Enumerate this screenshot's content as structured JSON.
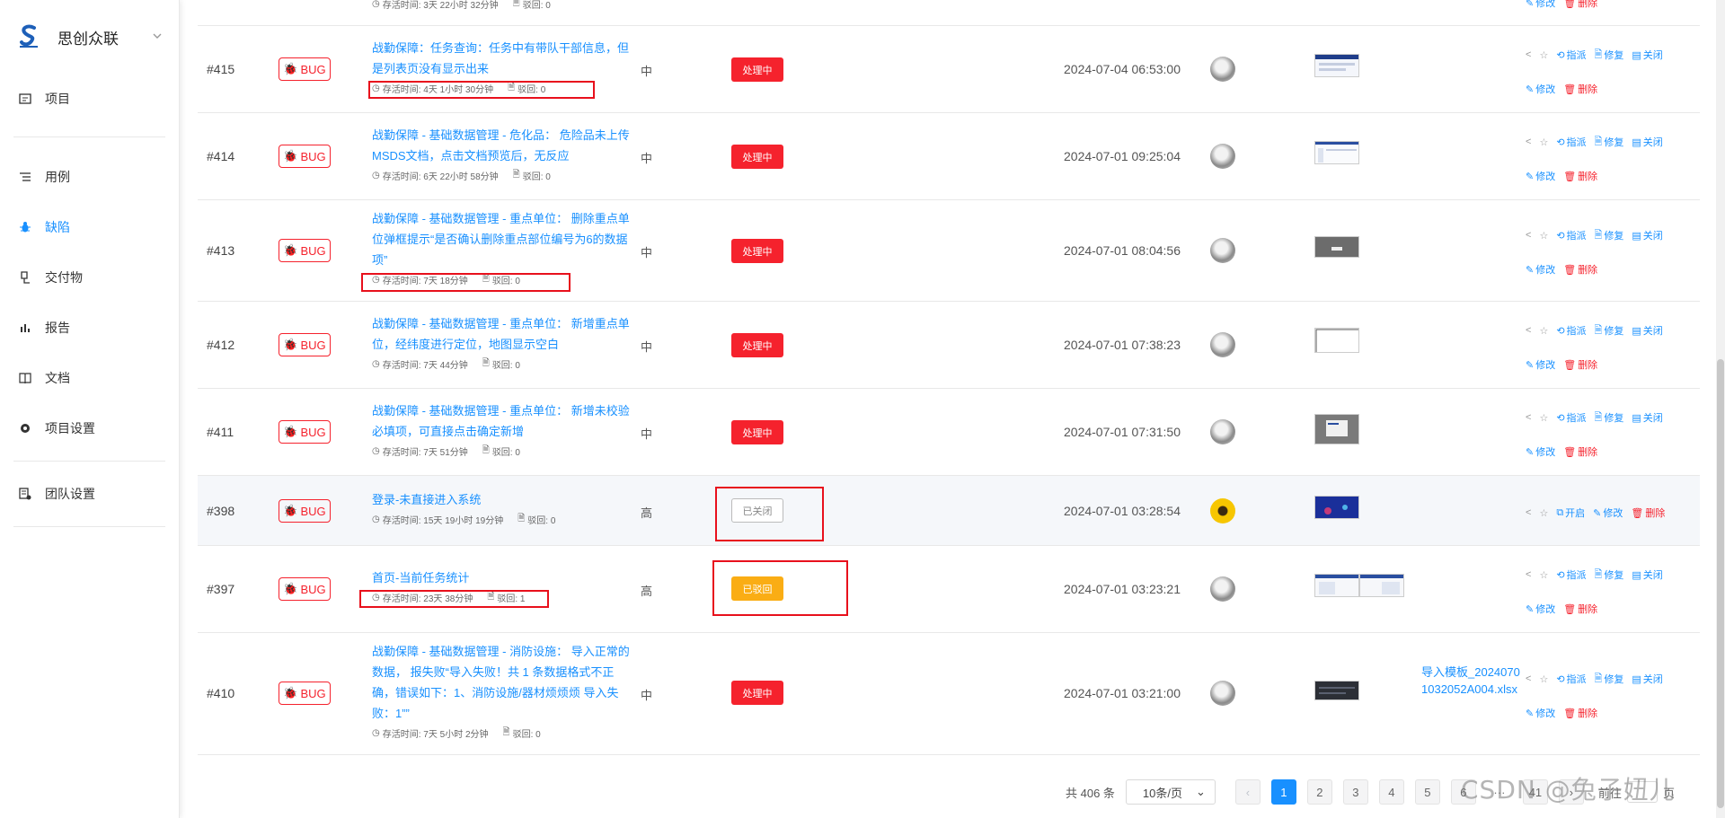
{
  "sidebar": {
    "brand": "思创众联",
    "items": [
      {
        "label": "项目",
        "icon": "project-icon",
        "active": false
      },
      {
        "label": "用例",
        "icon": "list-icon",
        "active": false
      },
      {
        "label": "缺陷",
        "icon": "bug-icon",
        "active": true
      },
      {
        "label": "交付物",
        "icon": "deliverable-icon",
        "active": false
      },
      {
        "label": "报告",
        "icon": "chart-icon",
        "active": false
      },
      {
        "label": "文档",
        "icon": "book-icon",
        "active": false
      },
      {
        "label": "项目设置",
        "icon": "gear-icon",
        "active": false
      },
      {
        "label": "团队设置",
        "icon": "team-icon",
        "active": false
      }
    ]
  },
  "top_partial": {
    "meta_time": "存活时间: 3天 22小时 32分钟",
    "meta_reject": "驳回: 0",
    "edit": "修改",
    "delete": "删除"
  },
  "labels": {
    "bug": "BUG",
    "assign": "指派",
    "fix": "修复",
    "close": "关闭",
    "edit": "修改",
    "delete": "删除",
    "reopen": "开启"
  },
  "rows": [
    {
      "id": "#415",
      "title": "战勤保障：任务查询：任务中有带队干部信息，但是列表页没有显示出来",
      "time": "存活时间: 4天 1小时 30分钟",
      "reject": "驳回: 0",
      "priority": "中",
      "status": "处理中",
      "date": "2024-07-04 06:53:00",
      "attachment": ""
    },
    {
      "id": "#414",
      "title": "战勤保障 - 基础数据管理 - 危化品： 危险品未上传MSDS文档，点击文档预览后，无反应",
      "time": "存活时间: 6天 22小时 58分钟",
      "reject": "驳回: 0",
      "priority": "中",
      "status": "处理中",
      "date": "2024-07-01 09:25:04",
      "attachment": ""
    },
    {
      "id": "#413",
      "title": "战勤保障 - 基础数据管理 - 重点单位： 删除重点单位弹框提示“是否确认删除重点部位编号为6的数据项”",
      "time": "存活时间: 7天 18分钟",
      "reject": "驳回: 0",
      "priority": "中",
      "status": "处理中",
      "date": "2024-07-01 08:04:56",
      "attachment": ""
    },
    {
      "id": "#412",
      "title": "战勤保障 - 基础数据管理 - 重点单位： 新增重点单位，经纬度进行定位，地图显示空白",
      "time": "存活时间: 7天 44分钟",
      "reject": "驳回: 0",
      "priority": "中",
      "status": "处理中",
      "date": "2024-07-01 07:38:23",
      "attachment": ""
    },
    {
      "id": "#411",
      "title": "战勤保障 - 基础数据管理 - 重点单位： 新增未校验必填项，可直接点击确定新增",
      "time": "存活时间: 7天 51分钟",
      "reject": "驳回: 0",
      "priority": "中",
      "status": "处理中",
      "date": "2024-07-01 07:31:50",
      "attachment": ""
    },
    {
      "id": "#398",
      "title": "登录-未直接进入系统",
      "time": "存活时间: 15天 19小时 19分钟",
      "reject": "驳回: 0",
      "priority": "高",
      "status": "已关闭",
      "date": "2024-07-01 03:28:54",
      "attachment": ""
    },
    {
      "id": "#397",
      "title": "首页-当前任务统计",
      "time": "存活时间: 23天 38分钟",
      "reject": "驳回: 1",
      "priority": "高",
      "status": "已驳回",
      "date": "2024-07-01 03:23:21",
      "attachment": ""
    },
    {
      "id": "#410",
      "title": "战勤保障 - 基础数据管理 - 消防设施： 导入正常的数据， 报失败“导入失败！共 1 条数据格式不正确，错误如下：1、消防设施/器材烦烦烦 导入失败：1””",
      "time": "存活时间: 7天 5小时 2分钟",
      "reject": "驳回: 0",
      "priority": "中",
      "status": "处理中",
      "date": "2024-07-01 03:21:00",
      "attachment": "导入模板_20240701032052A004.xlsx"
    }
  ],
  "pagination": {
    "total": "共 406 条",
    "page_size": "10条/页",
    "pages": [
      "1",
      "2",
      "3",
      "4",
      "5",
      "6"
    ],
    "more": "···",
    "last": "41",
    "goto_prefix": "前往",
    "goto_suffix": "页",
    "current": 1
  },
  "watermark": "CSDN @兔子妞儿",
  "colors": {
    "accent": "#1890ff",
    "danger": "#f5222d",
    "warning": "#faad14"
  }
}
